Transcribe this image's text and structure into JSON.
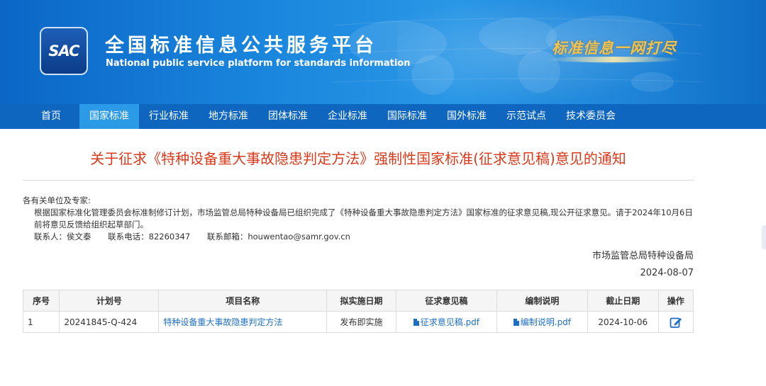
{
  "header": {
    "logo_text": "SAC",
    "site_title": "全国标准信息公共服务平台",
    "site_subtitle": "National public service platform  for standards information",
    "slogan": "标准信息一网打尽"
  },
  "nav": {
    "items": [
      {
        "label": "首页"
      },
      {
        "label": "国家标准",
        "active": true
      },
      {
        "label": "行业标准"
      },
      {
        "label": "地方标准"
      },
      {
        "label": "团体标准"
      },
      {
        "label": "企业标准"
      },
      {
        "label": "国际标准"
      },
      {
        "label": "国外标准"
      },
      {
        "label": "示范试点"
      },
      {
        "label": "技术委员会"
      }
    ]
  },
  "notice": {
    "title": "关于征求《特种设备重大事故隐患判定方法》强制性国家标准(征求意见稿)意见的通知",
    "salutation": "各有关单位及专家:",
    "body": "根据国家标准化管理委员会标准制修订计划，市场监管总局特种设备局已组织完成了《特种设备重大事故隐患判定方法》国家标准的征求意见稿,现公开征求意见。请于2024年10月6日前将意见反馈给组织起草部门。",
    "contact_person": "联系人：侯文泰",
    "contact_phone": "联系电话：82260347",
    "contact_email": "联系邮箱：houwentao@samr.gov.cn",
    "issuer": "市场监管总局特种设备局",
    "date": "2024-08-07"
  },
  "table": {
    "headers": {
      "seq": "序号",
      "plan_no": "计划号",
      "project": "项目名称",
      "impl_date": "拟实施日期",
      "draft": "征求意见稿",
      "explain": "编制说明",
      "deadline": "截止日期",
      "action": "操作"
    },
    "rows": [
      {
        "seq": "1",
        "plan_no": "20241845-Q-424",
        "project": "特种设备重大事故隐患判定方法",
        "impl_date": "发布即实施",
        "draft": "征求意见稿.pdf",
        "explain": "编制说明.pdf",
        "deadline": "2024-10-06",
        "action_icon": "edit-icon"
      }
    ]
  },
  "colors": {
    "banner": "#1a86dd",
    "nav": "#0e66bf",
    "nav_active": "#2b9be8",
    "title_red": "#d93a1c",
    "link_blue": "#1d6fc4",
    "slogan_gold": "#f2c24a"
  }
}
